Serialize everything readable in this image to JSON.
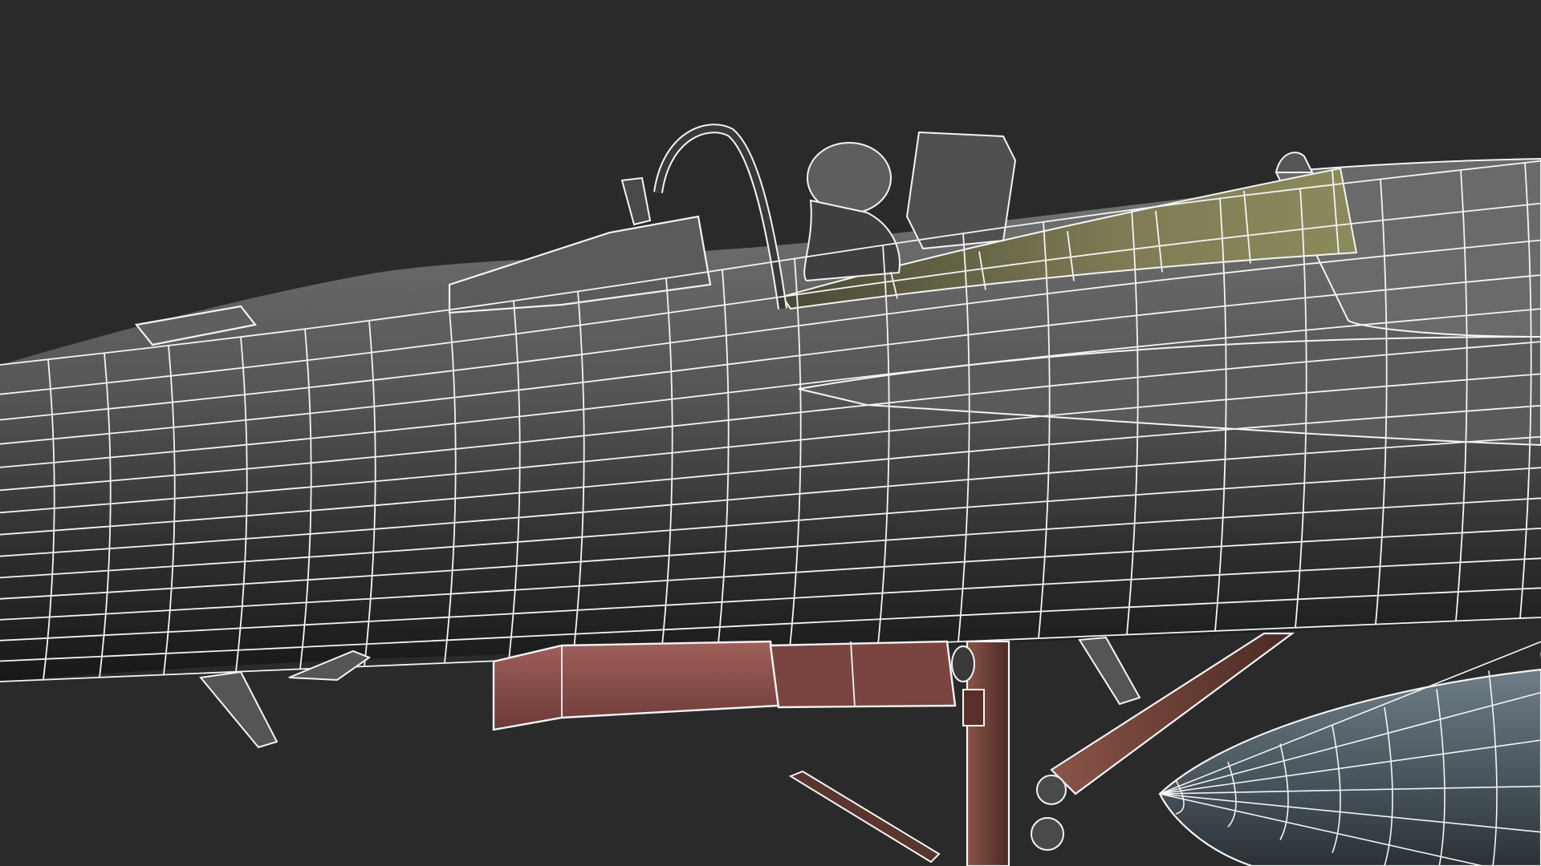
{
  "scene": {
    "subject": "jet-aircraft-wireframe",
    "style": "wireframe",
    "colors": {
      "background": "#2a2a2a",
      "wire": "#f4f4f4",
      "fuselage_light": "#6c6c6c",
      "fuselage_dark": "#1f1f1f",
      "canopy_tint": "#7c7a52",
      "weapon_bay": "#8a4e4a",
      "strut": "#6b3f36",
      "drop_tank": "#5d6a72"
    }
  }
}
